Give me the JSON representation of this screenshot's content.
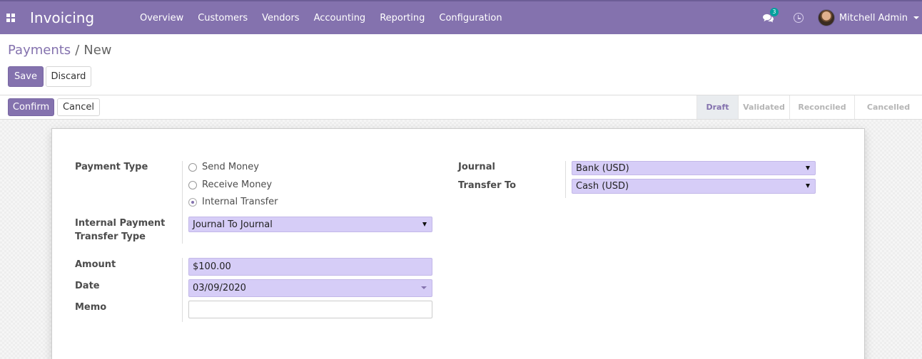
{
  "app": {
    "name": "Invoicing"
  },
  "menu": [
    "Overview",
    "Customers",
    "Vendors",
    "Accounting",
    "Reporting",
    "Configuration"
  ],
  "systray": {
    "chat_count": "3",
    "user_name": "Mitchell Admin"
  },
  "breadcrumb": {
    "parent": "Payments",
    "separator": "/",
    "current": "New"
  },
  "buttons": {
    "save": "Save",
    "discard": "Discard",
    "confirm": "Confirm",
    "cancel": "Cancel"
  },
  "stages": [
    {
      "label": "Draft",
      "active": true
    },
    {
      "label": "Validated",
      "active": false
    },
    {
      "label": "Reconciled",
      "active": false
    },
    {
      "label": "Cancelled",
      "active": false
    }
  ],
  "form": {
    "payment_type_label": "Payment Type",
    "payment_type_options": [
      "Send Money",
      "Receive Money",
      "Internal Transfer"
    ],
    "payment_type_selected": "Internal Transfer",
    "internal_transfer_label": "Internal Payment Transfer Type",
    "internal_transfer_value": "Journal To Journal",
    "amount_label": "Amount",
    "amount_value": "$100.00",
    "date_label": "Date",
    "date_value": "03/09/2020",
    "memo_label": "Memo",
    "memo_value": "",
    "journal_label": "Journal",
    "journal_value": "Bank (USD)",
    "transfer_to_label": "Transfer To",
    "transfer_to_value": "Cash (USD)"
  },
  "colors": {
    "brand": "#8472ae",
    "field_required": "#d6cdf7",
    "badge": "#00a09d"
  }
}
